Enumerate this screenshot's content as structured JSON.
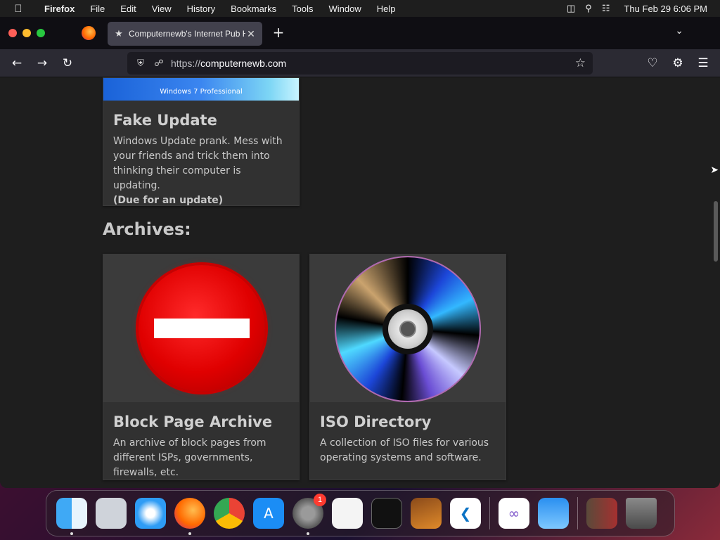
{
  "menubar": {
    "app_name": "Firefox",
    "items": [
      "File",
      "Edit",
      "View",
      "History",
      "Bookmarks",
      "Tools",
      "Window",
      "Help"
    ],
    "clock": "Thu Feb 29  6:06 PM"
  },
  "browser": {
    "tab_title": "Computernewb's Internet Pub H",
    "url_protocol": "https://",
    "url_host": "computernewb.com"
  },
  "page": {
    "fake_update": {
      "banner": "Windows 7 Professional",
      "title": "Fake Update",
      "description": "Windows Update prank. Mess with your friends and trick them into thinking their computer is updating.",
      "note": "(Due for an update)"
    },
    "archives_heading": "Archives:",
    "block_page": {
      "title": "Block Page Archive",
      "description": "An archive of block pages from different ISPs, governments, firewalls, etc."
    },
    "iso_directory": {
      "title": "ISO Directory",
      "description": "A collection of ISO files for various operating systems and software."
    }
  },
  "dock": {
    "settings_badge": "1"
  },
  "colors": {
    "page_bg": "#1e1e1e",
    "card_bg": "#313131",
    "tab_bg": "#42414d",
    "toolbar_bg": "#2b2a33"
  }
}
